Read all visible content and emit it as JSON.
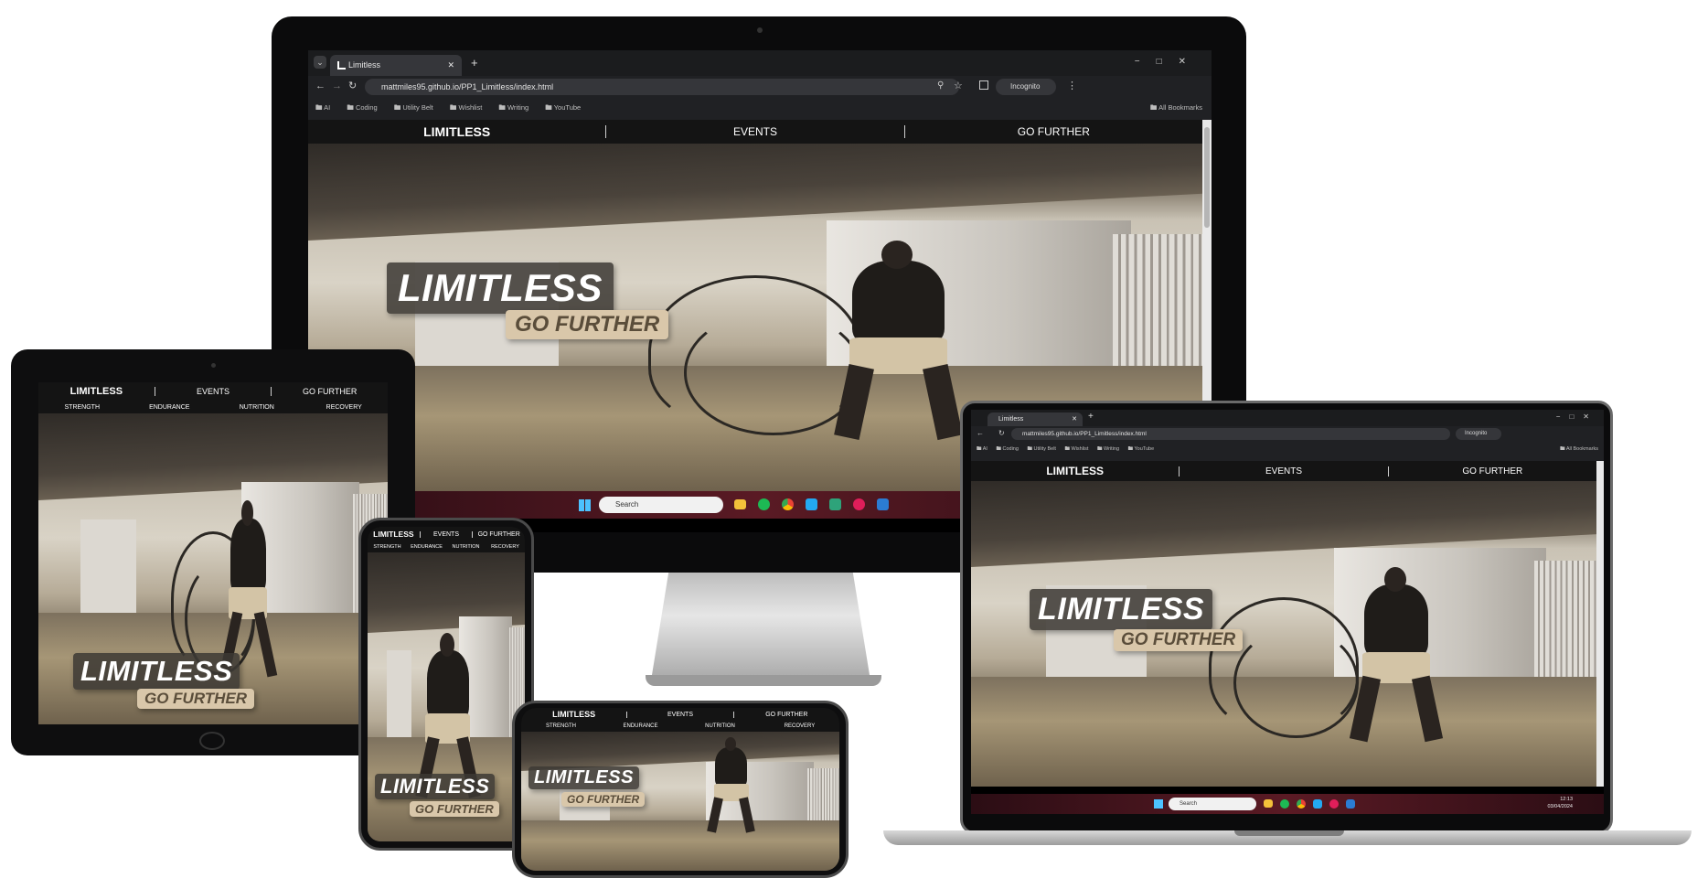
{
  "site": {
    "brand": "LIMITLESS",
    "nav": [
      "EVENTS",
      "GO FURTHER"
    ],
    "subnav": [
      "STRENGTH",
      "ENDURANCE",
      "NUTRITION",
      "RECOVERY"
    ],
    "hero_title": "LIMITLESS",
    "hero_subtitle": "GO FURTHER"
  },
  "browser": {
    "tab_title": "Limitless",
    "new_tab": "+",
    "url": "mattmiles95.github.io/PP1_Limitless/index.html",
    "incognito": "Incognito",
    "bookmarks": [
      "AI",
      "Coding",
      "Utility Belt",
      "Wishlist",
      "Writing",
      "YouTube"
    ],
    "all_bookmarks": "All Bookmarks",
    "all_bookmarks_laptop": "All Bookmarks",
    "window_controls": [
      "−",
      "□",
      "✕"
    ]
  },
  "taskbar": {
    "search_placeholder": "Search",
    "clock_time": "12:13",
    "clock_date": "03/04/2024"
  },
  "colors": {
    "nav_bg": "#141414",
    "logo_box": "#3c3834",
    "logo_sub_bg": "#d9c7aa",
    "logo_sub_text": "#5a4d3a",
    "taskbar": "#5a1a24"
  }
}
